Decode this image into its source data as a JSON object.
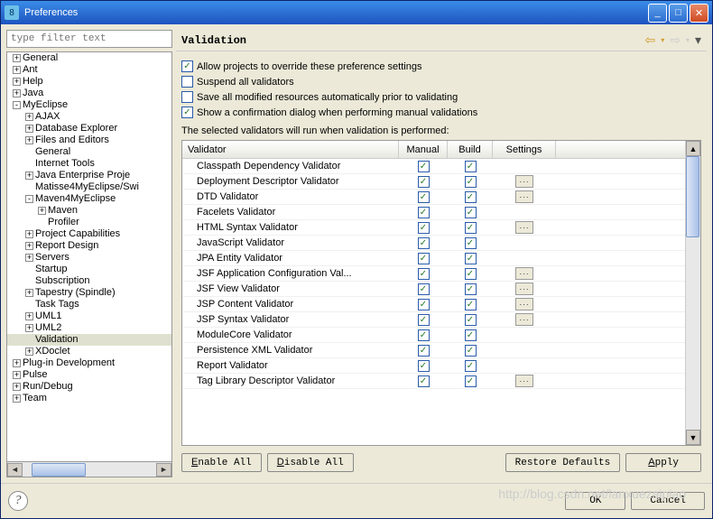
{
  "window": {
    "title": "Preferences"
  },
  "filter_placeholder": "type filter text",
  "tree": [
    {
      "d": 0,
      "e": "+",
      "l": "General"
    },
    {
      "d": 0,
      "e": "+",
      "l": "Ant"
    },
    {
      "d": 0,
      "e": "+",
      "l": "Help"
    },
    {
      "d": 0,
      "e": "+",
      "l": "Java"
    },
    {
      "d": 0,
      "e": "-",
      "l": "MyEclipse"
    },
    {
      "d": 1,
      "e": "+",
      "l": "AJAX"
    },
    {
      "d": 1,
      "e": "+",
      "l": "Database Explorer"
    },
    {
      "d": 1,
      "e": "+",
      "l": "Files and Editors"
    },
    {
      "d": 1,
      "e": "",
      "l": "General"
    },
    {
      "d": 1,
      "e": "",
      "l": "Internet Tools"
    },
    {
      "d": 1,
      "e": "+",
      "l": "Java Enterprise Proje"
    },
    {
      "d": 1,
      "e": "",
      "l": "Matisse4MyEclipse/Swi"
    },
    {
      "d": 1,
      "e": "-",
      "l": "Maven4MyEclipse"
    },
    {
      "d": 2,
      "e": "+",
      "l": "Maven"
    },
    {
      "d": 2,
      "e": "",
      "l": "Profiler"
    },
    {
      "d": 1,
      "e": "+",
      "l": "Project Capabilities"
    },
    {
      "d": 1,
      "e": "+",
      "l": "Report Design"
    },
    {
      "d": 1,
      "e": "+",
      "l": "Servers"
    },
    {
      "d": 1,
      "e": "",
      "l": "Startup"
    },
    {
      "d": 1,
      "e": "",
      "l": "Subscription"
    },
    {
      "d": 1,
      "e": "+",
      "l": "Tapestry (Spindle)"
    },
    {
      "d": 1,
      "e": "",
      "l": "Task Tags"
    },
    {
      "d": 1,
      "e": "+",
      "l": "UML1"
    },
    {
      "d": 1,
      "e": "+",
      "l": "UML2"
    },
    {
      "d": 1,
      "e": "",
      "l": "Validation",
      "sel": true
    },
    {
      "d": 1,
      "e": "+",
      "l": "XDoclet"
    },
    {
      "d": 0,
      "e": "+",
      "l": "Plug-in Development"
    },
    {
      "d": 0,
      "e": "+",
      "l": "Pulse"
    },
    {
      "d": 0,
      "e": "+",
      "l": "Run/Debug"
    },
    {
      "d": 0,
      "e": "+",
      "l": "Team"
    }
  ],
  "page_title": "Validation",
  "options": [
    {
      "checked": true,
      "label": "Allow projects to override these preference settings"
    },
    {
      "checked": false,
      "label": "Suspend all validators"
    },
    {
      "checked": false,
      "label": "Save all modified resources automatically prior to validating"
    },
    {
      "checked": true,
      "label": "Show a confirmation dialog when performing manual validations"
    }
  ],
  "note": "The selected validators will run when validation is performed:",
  "columns": {
    "c0": "Validator",
    "c1": "Manual",
    "c2": "Build",
    "c3": "Settings"
  },
  "validators": [
    {
      "name": "Classpath Dependency Validator",
      "m": true,
      "b": true,
      "s": false
    },
    {
      "name": "Deployment Descriptor Validator",
      "m": true,
      "b": true,
      "s": true
    },
    {
      "name": "DTD Validator",
      "m": true,
      "b": true,
      "s": true
    },
    {
      "name": "Facelets Validator",
      "m": true,
      "b": true,
      "s": false
    },
    {
      "name": "HTML Syntax Validator",
      "m": true,
      "b": true,
      "s": true
    },
    {
      "name": "JavaScript Validator",
      "m": true,
      "b": true,
      "s": false
    },
    {
      "name": "JPA Entity Validator",
      "m": true,
      "b": true,
      "s": false
    },
    {
      "name": "JSF Application Configuration Val...",
      "m": true,
      "b": true,
      "s": true
    },
    {
      "name": "JSF View Validator",
      "m": true,
      "b": true,
      "s": true
    },
    {
      "name": "JSP Content Validator",
      "m": true,
      "b": true,
      "s": true
    },
    {
      "name": "JSP Syntax Validator",
      "m": true,
      "b": true,
      "s": true
    },
    {
      "name": "ModuleCore Validator",
      "m": true,
      "b": true,
      "s": false
    },
    {
      "name": "Persistence XML Validator",
      "m": true,
      "b": true,
      "s": false
    },
    {
      "name": "Report Validator",
      "m": true,
      "b": true,
      "s": false
    },
    {
      "name": "Tag Library Descriptor Validator",
      "m": true,
      "b": true,
      "s": true
    }
  ],
  "buttons": {
    "enable_all": "Enable All",
    "disable_all": "Disable All",
    "restore": "Restore Defaults",
    "apply": "Apply",
    "ok": "OK",
    "cancel": "Cancel"
  },
  "watermark": "http://blog.csdn.net/lanxuezaipiao"
}
